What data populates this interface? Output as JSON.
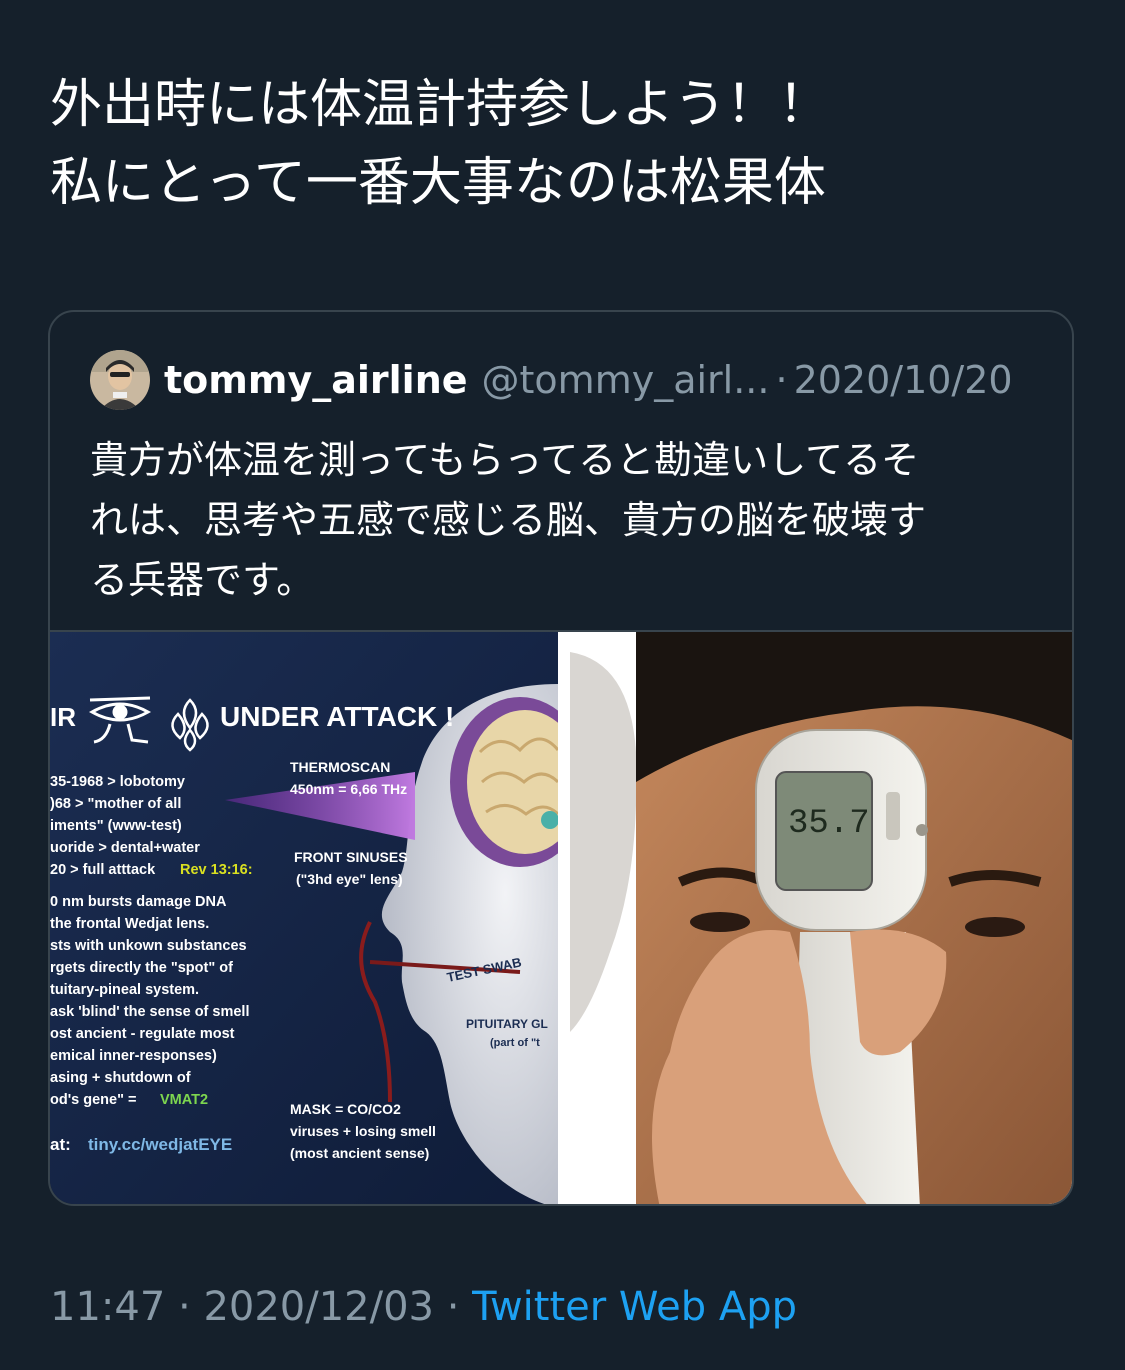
{
  "tweet": {
    "lines": [
      "外出時には体温計持参しよう！！",
      "私にとって一番大事なのは松果体"
    ],
    "time": "11:47",
    "separator": "·",
    "date": "2020/12/03",
    "source": "Twitter Web App"
  },
  "quote": {
    "name": "tommy_airline",
    "handle": "@tommy_airl...",
    "separator": "·",
    "date": "2020/10/20",
    "lines": [
      "貴方が体温を測ってもらってると勘違いしてるそ",
      "れは、思考や五感で感じる脳、貴方の脳を破壊す",
      "る兵器です。"
    ]
  },
  "infographic": {
    "title": "UNDER ATTACK !",
    "title_prefix": "IR",
    "left_lines": [
      "35-1968 > lobotomy",
      ")68 > \"mother of all",
      "iments\" (www-test)",
      "uoride > dental+water",
      "20 > full atttack",
      "0 nm bursts damage DNA",
      "the frontal Wedjat lens.",
      "sts with unkown substances",
      "rgets directly the \"spot\" of",
      "tuitary-pineal system.",
      "ask 'blind' the sense of smell",
      "ost ancient - regulate most",
      "emical inner-responses)",
      "asing + shutdown of",
      "od's gene\" ="
    ],
    "rev_ref": "Rev 13:16:",
    "vmat": "VMAT2",
    "link_prefix": "at:",
    "link": "tiny.cc/wedjatEYE",
    "thermoscan": "THERMOSCAN",
    "thermo_freq": "450nm = 6,66 THz",
    "front_sinuses": "FRONT SINUSES",
    "third_eye": "(\"3hd eye\" lens)",
    "test_swab": "TEST SWAB",
    "pituitary": "PITUITARY GL",
    "pituitary_part": "(part of \"t",
    "mask": "MASK = CO/CO2",
    "viruses": "viruses + losing smell",
    "ancient": "(most ancient sense)"
  },
  "thermometer": {
    "reading": "35.7"
  },
  "colors": {
    "background": "#15202b",
    "border": "#38444d",
    "secondary_text": "#8899a6",
    "link": "#1da1f2",
    "infographic_bg": "#16284a",
    "yellow": "#d9e021",
    "green": "#7dd64f",
    "cyan": "#7fb8e6"
  }
}
